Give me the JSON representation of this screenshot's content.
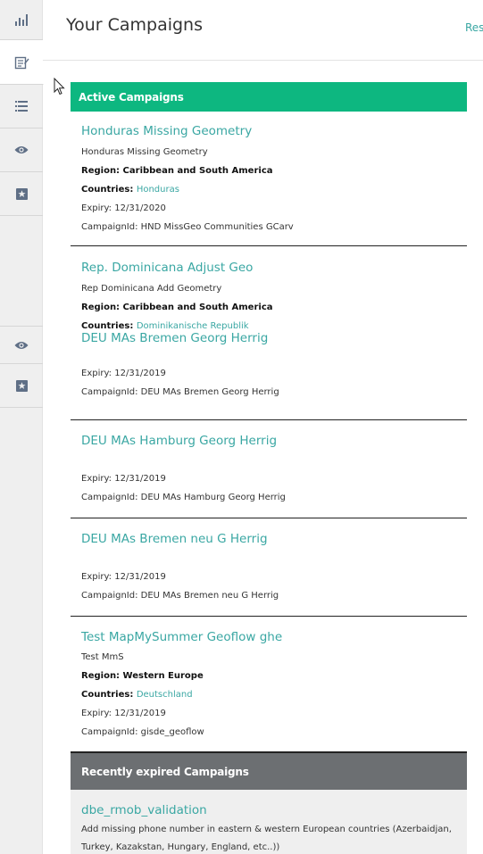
{
  "header": {
    "title": "Your Campaigns",
    "link": "Rese"
  },
  "sidebar": {
    "items": [
      {
        "icon": "bar-chart-icon"
      },
      {
        "icon": "edit-campaign-icon"
      },
      {
        "icon": "list-icon"
      },
      {
        "icon": "eye-icon"
      },
      {
        "icon": "star-icon"
      },
      {
        "icon": "eye-icon"
      },
      {
        "icon": "star-icon"
      }
    ]
  },
  "active_section": {
    "label": "Active Campaigns"
  },
  "labels": {
    "region": "Region:",
    "countries": "Countries:",
    "expiry": "Expiry:",
    "campaign_id": "CampaignId:"
  },
  "campaigns": [
    {
      "title": "Honduras Missing Geometry",
      "subtitle": "Honduras Missing Geometry",
      "region": "Caribbean and South America",
      "countries": "Honduras",
      "expiry": "12/31/2020",
      "campaign_id": "HND MissGeo Communities GCarv"
    },
    {
      "title": "Rep. Dominicana Adjust Geo",
      "subtitle": "Rep Dominicana Add Geometry",
      "region": "Caribbean and South America",
      "countries": "Dominikanische Republik"
    },
    {
      "title": "DEU MAs Bremen Georg Herrig",
      "expiry": "12/31/2019",
      "campaign_id": "DEU MAs Bremen Georg Herrig"
    },
    {
      "title": "DEU MAs Hamburg Georg Herrig",
      "expiry": "12/31/2019",
      "campaign_id": "DEU MAs Hamburg Georg Herrig"
    },
    {
      "title": "DEU MAs Bremen neu G Herrig",
      "expiry": "12/31/2019",
      "campaign_id": "DEU MAs Bremen neu G Herrig"
    },
    {
      "title": "Test MapMySummer Geoflow ghe",
      "subtitle": "Test MmS",
      "region": "Western Europe",
      "countries": "Deutschland",
      "expiry": "12/31/2019",
      "campaign_id": "gisde_geoflow"
    }
  ],
  "expired_section": {
    "label": "Recently expired Campaigns"
  },
  "expired_campaigns": [
    {
      "title": "dbe_rmob_validation",
      "description": "Add missing phone number in eastern & western European countries (Azerbaidjan, Turkey, Kazakstan, Hungary, England, etc..))"
    }
  ],
  "colors": {
    "accent": "#3aa7a3",
    "active_header": "#0db780",
    "expired_header": "#6c6f72"
  }
}
